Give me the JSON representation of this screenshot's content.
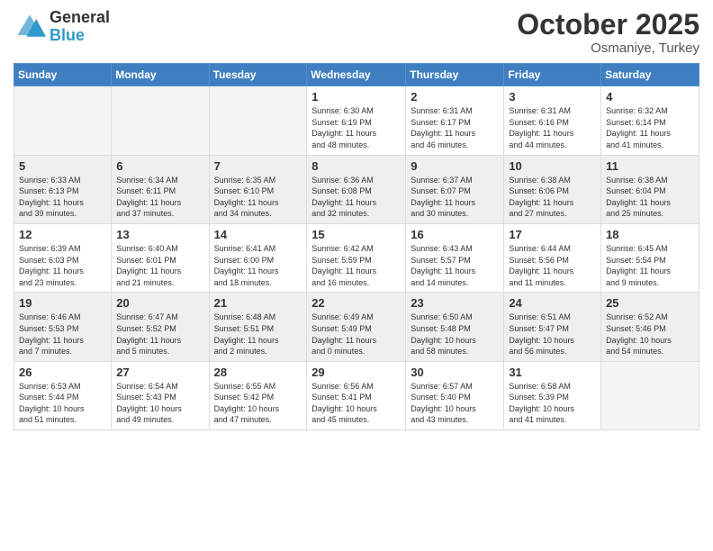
{
  "header": {
    "logo_general": "General",
    "logo_blue": "Blue",
    "month": "October 2025",
    "location": "Osmaniye, Turkey"
  },
  "days_of_week": [
    "Sunday",
    "Monday",
    "Tuesday",
    "Wednesday",
    "Thursday",
    "Friday",
    "Saturday"
  ],
  "weeks": [
    {
      "days": [
        {
          "num": "",
          "info": ""
        },
        {
          "num": "",
          "info": ""
        },
        {
          "num": "",
          "info": ""
        },
        {
          "num": "1",
          "info": "Sunrise: 6:30 AM\nSunset: 6:19 PM\nDaylight: 11 hours\nand 48 minutes."
        },
        {
          "num": "2",
          "info": "Sunrise: 6:31 AM\nSunset: 6:17 PM\nDaylight: 11 hours\nand 46 minutes."
        },
        {
          "num": "3",
          "info": "Sunrise: 6:31 AM\nSunset: 6:16 PM\nDaylight: 11 hours\nand 44 minutes."
        },
        {
          "num": "4",
          "info": "Sunrise: 6:32 AM\nSunset: 6:14 PM\nDaylight: 11 hours\nand 41 minutes."
        }
      ]
    },
    {
      "days": [
        {
          "num": "5",
          "info": "Sunrise: 6:33 AM\nSunset: 6:13 PM\nDaylight: 11 hours\nand 39 minutes."
        },
        {
          "num": "6",
          "info": "Sunrise: 6:34 AM\nSunset: 6:11 PM\nDaylight: 11 hours\nand 37 minutes."
        },
        {
          "num": "7",
          "info": "Sunrise: 6:35 AM\nSunset: 6:10 PM\nDaylight: 11 hours\nand 34 minutes."
        },
        {
          "num": "8",
          "info": "Sunrise: 6:36 AM\nSunset: 6:08 PM\nDaylight: 11 hours\nand 32 minutes."
        },
        {
          "num": "9",
          "info": "Sunrise: 6:37 AM\nSunset: 6:07 PM\nDaylight: 11 hours\nand 30 minutes."
        },
        {
          "num": "10",
          "info": "Sunrise: 6:38 AM\nSunset: 6:06 PM\nDaylight: 11 hours\nand 27 minutes."
        },
        {
          "num": "11",
          "info": "Sunrise: 6:38 AM\nSunset: 6:04 PM\nDaylight: 11 hours\nand 25 minutes."
        }
      ]
    },
    {
      "days": [
        {
          "num": "12",
          "info": "Sunrise: 6:39 AM\nSunset: 6:03 PM\nDaylight: 11 hours\nand 23 minutes."
        },
        {
          "num": "13",
          "info": "Sunrise: 6:40 AM\nSunset: 6:01 PM\nDaylight: 11 hours\nand 21 minutes."
        },
        {
          "num": "14",
          "info": "Sunrise: 6:41 AM\nSunset: 6:00 PM\nDaylight: 11 hours\nand 18 minutes."
        },
        {
          "num": "15",
          "info": "Sunrise: 6:42 AM\nSunset: 5:59 PM\nDaylight: 11 hours\nand 16 minutes."
        },
        {
          "num": "16",
          "info": "Sunrise: 6:43 AM\nSunset: 5:57 PM\nDaylight: 11 hours\nand 14 minutes."
        },
        {
          "num": "17",
          "info": "Sunrise: 6:44 AM\nSunset: 5:56 PM\nDaylight: 11 hours\nand 11 minutes."
        },
        {
          "num": "18",
          "info": "Sunrise: 6:45 AM\nSunset: 5:54 PM\nDaylight: 11 hours\nand 9 minutes."
        }
      ]
    },
    {
      "days": [
        {
          "num": "19",
          "info": "Sunrise: 6:46 AM\nSunset: 5:53 PM\nDaylight: 11 hours\nand 7 minutes."
        },
        {
          "num": "20",
          "info": "Sunrise: 6:47 AM\nSunset: 5:52 PM\nDaylight: 11 hours\nand 5 minutes."
        },
        {
          "num": "21",
          "info": "Sunrise: 6:48 AM\nSunset: 5:51 PM\nDaylight: 11 hours\nand 2 minutes."
        },
        {
          "num": "22",
          "info": "Sunrise: 6:49 AM\nSunset: 5:49 PM\nDaylight: 11 hours\nand 0 minutes."
        },
        {
          "num": "23",
          "info": "Sunrise: 6:50 AM\nSunset: 5:48 PM\nDaylight: 10 hours\nand 58 minutes."
        },
        {
          "num": "24",
          "info": "Sunrise: 6:51 AM\nSunset: 5:47 PM\nDaylight: 10 hours\nand 56 minutes."
        },
        {
          "num": "25",
          "info": "Sunrise: 6:52 AM\nSunset: 5:46 PM\nDaylight: 10 hours\nand 54 minutes."
        }
      ]
    },
    {
      "days": [
        {
          "num": "26",
          "info": "Sunrise: 6:53 AM\nSunset: 5:44 PM\nDaylight: 10 hours\nand 51 minutes."
        },
        {
          "num": "27",
          "info": "Sunrise: 6:54 AM\nSunset: 5:43 PM\nDaylight: 10 hours\nand 49 minutes."
        },
        {
          "num": "28",
          "info": "Sunrise: 6:55 AM\nSunset: 5:42 PM\nDaylight: 10 hours\nand 47 minutes."
        },
        {
          "num": "29",
          "info": "Sunrise: 6:56 AM\nSunset: 5:41 PM\nDaylight: 10 hours\nand 45 minutes."
        },
        {
          "num": "30",
          "info": "Sunrise: 6:57 AM\nSunset: 5:40 PM\nDaylight: 10 hours\nand 43 minutes."
        },
        {
          "num": "31",
          "info": "Sunrise: 6:58 AM\nSunset: 5:39 PM\nDaylight: 10 hours\nand 41 minutes."
        },
        {
          "num": "",
          "info": ""
        }
      ]
    }
  ]
}
